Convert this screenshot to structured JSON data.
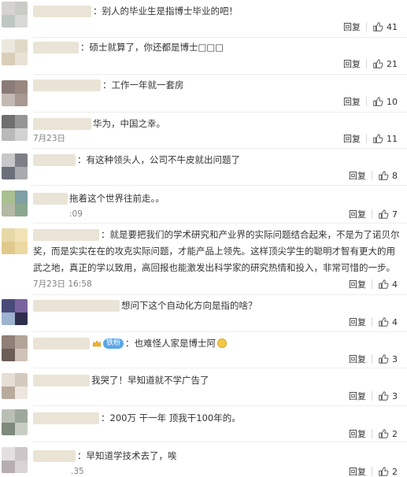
{
  "comments": [
    {
      "text": "别人的毕业生是指博士毕业的吧！",
      "time": "",
      "reply": "回复",
      "likes": "41",
      "avatar_colors": [
        "#d5d3cf",
        "#c9cbc5",
        "#bfc7c2",
        "#d8d9d4"
      ]
    },
    {
      "text": "硕士就算了，你还都是博士□□□",
      "time": "",
      "reply": "回复",
      "likes": "21",
      "avatar_colors": [
        "#ece8dd",
        "#e1d9c8",
        "#d9cfb8",
        "#e8e2d4"
      ]
    },
    {
      "text": "工作一年就一套房",
      "time": "",
      "reply": "回复",
      "likes": "10",
      "avatar_colors": [
        "#8a7b78",
        "#9a8780",
        "#c3b8b2",
        "#a79892"
      ]
    },
    {
      "text": "华为，中国之幸。",
      "time": "7月23日",
      "reply": "回复",
      "likes": "11",
      "avatar_colors": [
        "#6f6f6f",
        "#969696",
        "#b9b9b9",
        "#d2d2d2"
      ]
    },
    {
      "text": "有这种领头人，公司不牛皮就出问题了",
      "time": "",
      "reply": "回复",
      "likes": "8",
      "avatar_colors": [
        "#c8c7c9",
        "#7d7f86",
        "#6b6f7a",
        "#a8aab0"
      ]
    },
    {
      "text": "拖着这个世界往前走。。",
      "time": ":09",
      "reply": "回复",
      "likes": "7",
      "avatar_colors": [
        "#a9c08f",
        "#7e9fa3",
        "#b3b9a3",
        "#8aa88e"
      ]
    },
    {
      "text": "就是要把我们的学术研究和产业界的实际问题结合起来，不是为了诺贝尔奖，而是实实在在的攻克实际问题，才能产品上领先。这样顶尖学生的聪明才智有更大的用武之地，真正的学以致用，高回报也能激发出科学家的研究热情和投入，非常可惜的一步。",
      "time": "7月23日 16:58",
      "reply": "回复",
      "likes": "4",
      "avatar_colors": [
        "#e7d8a8",
        "#f1e3b5",
        "#e0c98d",
        "#ecd9a1"
      ]
    },
    {
      "text": "想问下这个自动化方向是指的啥？",
      "time": "",
      "reply": "回复",
      "likes": "4",
      "avatar_colors": [
        "#4a4a78",
        "#7b63a0",
        "#9db2cf",
        "#2f2f4d"
      ]
    },
    {
      "text": "也难怪人家是博士阿",
      "fan_badge": "铁粉",
      "time": "",
      "reply": "回复",
      "likes": "3",
      "avatar_colors": [
        "#8f7f76",
        "#b3a498",
        "#6b5e58",
        "#cfc2b6"
      ]
    },
    {
      "text": "我哭了！早知道就不学广告了",
      "time": "",
      "reply": "回复",
      "likes": "3",
      "avatar_colors": [
        "#e6dfd6",
        "#d3c9bd",
        "#b8ab9d",
        "#ece6de"
      ]
    },
    {
      "text": "200万 干一年 顶我干100年的。",
      "time": "",
      "reply": "回复",
      "likes": "2",
      "avatar_colors": [
        "#b9bfb5",
        "#9ea99b",
        "#7e8a7c",
        "#c8cdc4"
      ]
    },
    {
      "text": "早知道学技术去了，唉",
      "time": ".35",
      "reply": "回复",
      "likes": "2",
      "avatar_colors": [
        "#e4e0e1",
        "#cdc6c8",
        "#b7aeb1",
        "#d9d3d5"
      ]
    }
  ]
}
